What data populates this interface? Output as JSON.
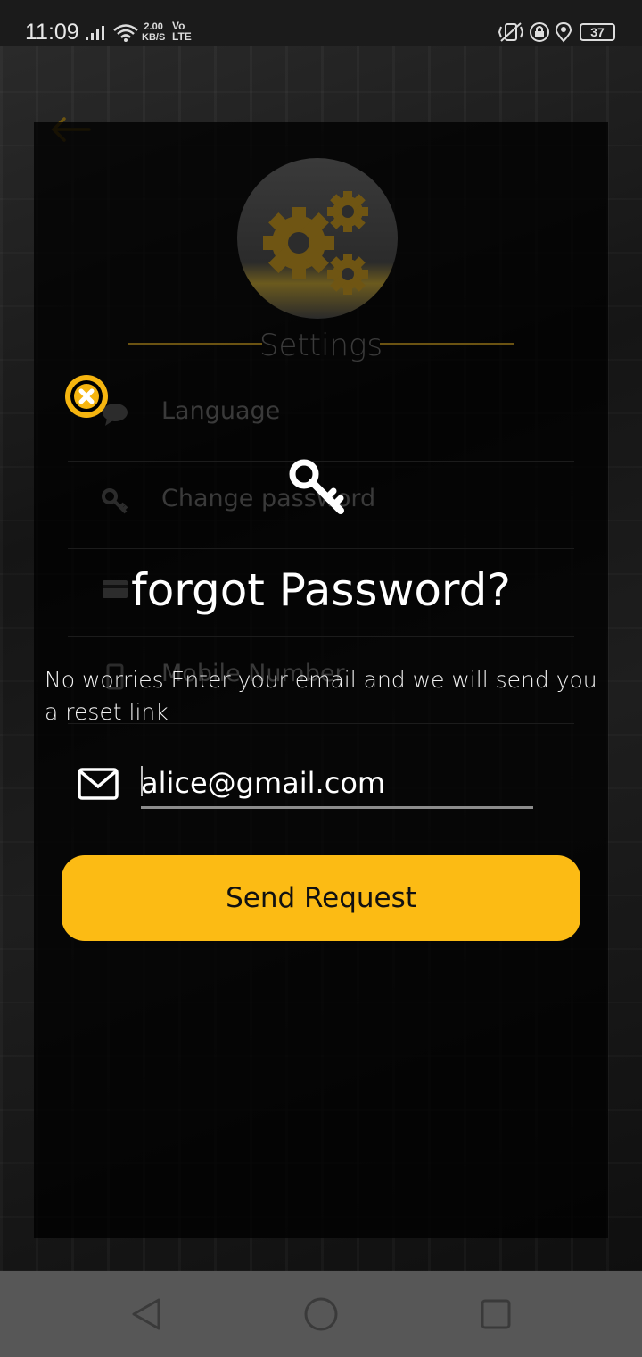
{
  "status_bar": {
    "time": "11:09",
    "network_speed_value": "2.00",
    "network_speed_unit": "KB/S",
    "volte_top": "Vo",
    "volte_bottom": "LTE",
    "battery": "37"
  },
  "background": {
    "settings_title": "Settings",
    "settings_items": [
      {
        "label": "Language",
        "icon": "chat-bubble-icon"
      },
      {
        "label": "Change password",
        "icon": "key-icon"
      },
      {
        "label": "",
        "icon": "credit-card-icon"
      },
      {
        "label": "Mobile Number",
        "icon": "phone-icon"
      }
    ]
  },
  "dialog": {
    "title": "forgot Password?",
    "description": "No worries Enter your email and we will send you a reset link",
    "email_value": "alice@gmail.com",
    "send_button_label": "Send Request"
  },
  "colors": {
    "accent": "#fcbb14",
    "background": "#000000",
    "nav_bar": "#575757"
  }
}
